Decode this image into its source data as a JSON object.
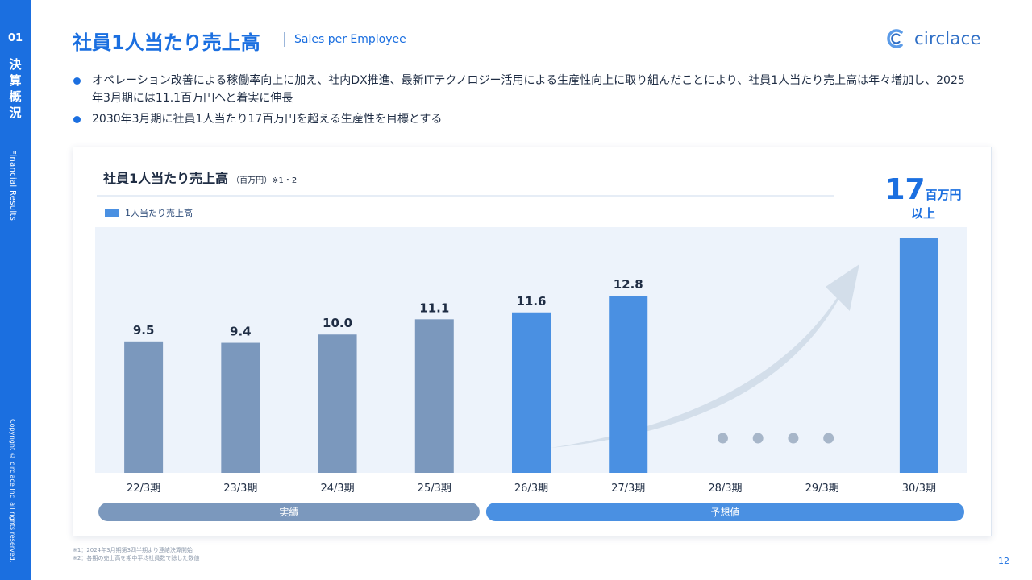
{
  "sidebar": {
    "number": "01",
    "section_jp": [
      "決",
      "算",
      "概",
      "況"
    ],
    "section_en": "Financial Results",
    "copyright": "Copyright © circlace Inc. all rights reserved."
  },
  "header": {
    "title": "社員1人当たり売上高",
    "subtitle": "Sales per Employee",
    "logo_text": "circlace"
  },
  "bullets": [
    "オペレーション改善による稼働率向上に加え、社内DX推進、最新ITテクノロジー活用による生産性向上に取り組んだことにより、社員1人当たり売上高は年々増加し、2025年3月期には11.1百万円へと着実に伸長",
    "2030年3月期に社員1人当たり17百万円を超える生産性を目標とする"
  ],
  "chart_data": {
    "type": "bar",
    "title": "社員1人当たり売上高",
    "unit_note": "（百万円）※1・2",
    "legend": [
      "1人当たり売上高"
    ],
    "categories": [
      "22/3期",
      "23/3期",
      "24/3期",
      "25/3期",
      "26/3期",
      "27/3期",
      "28/3期",
      "29/3期",
      "30/3期"
    ],
    "values": [
      9.5,
      9.4,
      10.0,
      11.1,
      11.6,
      12.8,
      null,
      null,
      17
    ],
    "value_labels": [
      "9.5",
      "9.4",
      "10.0",
      "11.1",
      "11.6",
      "12.8",
      "",
      "",
      ""
    ],
    "ylim": [
      0,
      17
    ],
    "grid": false,
    "groups": [
      {
        "label": "実績",
        "categories": [
          "22/3期",
          "23/3期",
          "24/3期",
          "25/3期"
        ],
        "color": "#7b98bd"
      },
      {
        "label": "予想値",
        "categories": [
          "26/3期",
          "27/3期",
          "28/3期",
          "29/3期",
          "30/3期"
        ],
        "color": "#4a90e2"
      }
    ],
    "target": {
      "value": "17",
      "unit": "百万円",
      "suffix": "以上"
    }
  },
  "footnotes": [
    "※1：2024年3月期第3四半期より連結決算開始",
    "※2：各期の売上高を期中平均社員数で除した数値"
  ],
  "page_number": "12",
  "colors": {
    "brand": "#1b6fe0",
    "actual": "#7b98bd",
    "forecast": "#4a90e2",
    "plot_bg": "#edf3fb",
    "arrow": "#d3deea"
  }
}
